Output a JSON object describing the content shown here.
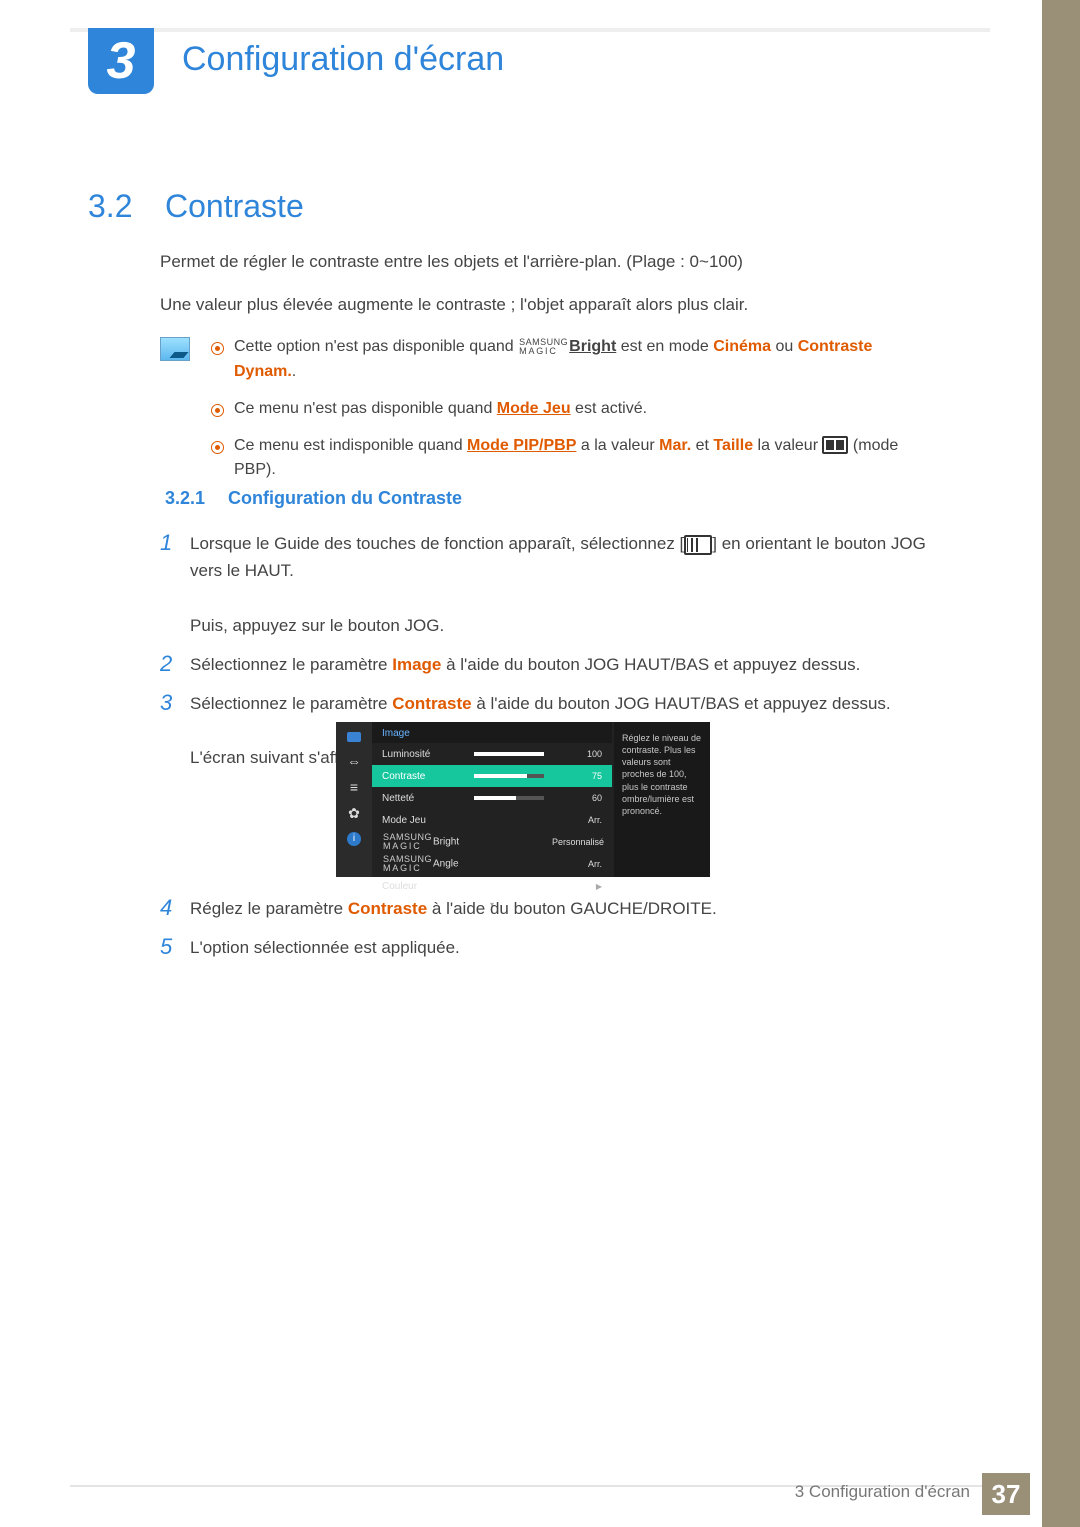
{
  "chapter": {
    "number": "3",
    "title": "Configuration d'écran"
  },
  "section": {
    "number": "3.2",
    "title": "Contraste",
    "p1": "Permet de régler le contraste entre les objets et l'arrière-plan. (Plage : 0~100)",
    "p2": "Une valeur plus élevée augmente le contraste ; l'objet apparaît alors plus clair."
  },
  "notes": {
    "n1a": "Cette option n'est pas disponible quand ",
    "n1_bright": "Bright",
    "n1b": " est en mode ",
    "n1_cinema": "Cinéma",
    "n1c": " ou ",
    "n1_dynam": "Contraste Dynam.",
    "n1d": ".",
    "n2a": "Ce menu n'est pas disponible quand ",
    "n2_mode": "Mode Jeu",
    "n2b": " est activé.",
    "n3a": "Ce menu est indisponible quand ",
    "n3_pip": "Mode PIP/PBP",
    "n3b": " a la valeur ",
    "n3_mar": "Mar.",
    "n3c": " et ",
    "n3_taille": "Taille",
    "n3d": " la valeur ",
    "n3e": " (mode PBP)."
  },
  "subsection": {
    "number": "3.2.1",
    "title": "Configuration du Contraste"
  },
  "steps": {
    "s1a": "Lorsque le Guide des touches de fonction apparaît, sélectionnez [",
    "s1b": "] en orientant le bouton JOG vers le HAUT.",
    "s1c": "Puis, appuyez sur le bouton JOG.",
    "s2a": "Sélectionnez le paramètre ",
    "s2_img": "Image",
    "s2b": " à l'aide du bouton JOG HAUT/BAS et appuyez dessus.",
    "s3a": "Sélectionnez le paramètre ",
    "s3_con": "Contraste",
    "s3b": " à l'aide du bouton JOG HAUT/BAS et appuyez dessus.",
    "s3c": "L'écran suivant s'affiche.",
    "s4a": "Réglez le paramètre ",
    "s4_con": "Contraste",
    "s4b": " à l'aide du bouton GAUCHE/DROITE.",
    "s5": "L'option sélectionnée est appliquée."
  },
  "step_nums": {
    "1": "1",
    "2": "2",
    "3": "3",
    "4": "4",
    "5": "5"
  },
  "osd": {
    "header": "Image",
    "rows": {
      "lum": {
        "label": "Luminosité",
        "val": "100",
        "pct": 100
      },
      "con": {
        "label": "Contraste",
        "val": "75",
        "pct": 75
      },
      "net": {
        "label": "Netteté",
        "val": "60",
        "pct": 60
      },
      "jeu": {
        "label": "Mode Jeu",
        "val": "Arr."
      },
      "bright": {
        "label": "Bright",
        "val": "Personnalisé"
      },
      "angle": {
        "label": "Angle",
        "val": "Arr."
      },
      "coul": {
        "label": "Couleur"
      }
    },
    "help": "Réglez le niveau de contraste. Plus les valeurs sont proches de 100, plus le contraste ombre/lumière est prononcé."
  },
  "magic": {
    "top": "SAMSUNG",
    "bot": "MAGIC"
  },
  "footer": {
    "text": "3 Configuration d'écran",
    "page": "37"
  }
}
